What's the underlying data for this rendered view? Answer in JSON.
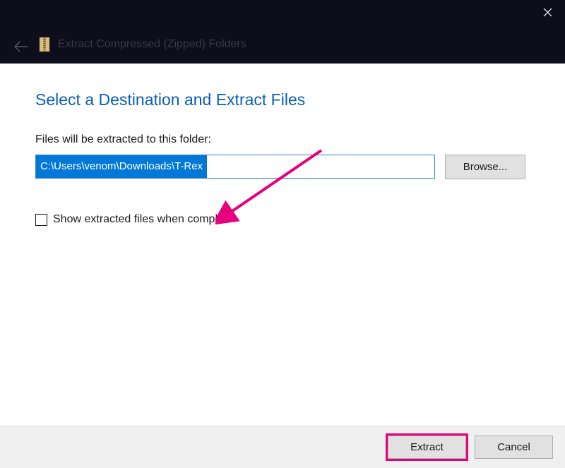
{
  "titlebar": {
    "window_title": "Extract Compressed (Zipped) Folders"
  },
  "content": {
    "header": "Select a Destination and Extract Files",
    "path_label": "Files will be extracted to this folder:",
    "path_value": "C:\\Users\\venom\\Downloads\\T-Rex",
    "browse_button": "Browse...",
    "checkbox_label": "Show extracted files when complete"
  },
  "footer": {
    "extract_button": "Extract",
    "cancel_button": "Cancel"
  },
  "annotation": {
    "arrow_color": "#e6007e"
  }
}
